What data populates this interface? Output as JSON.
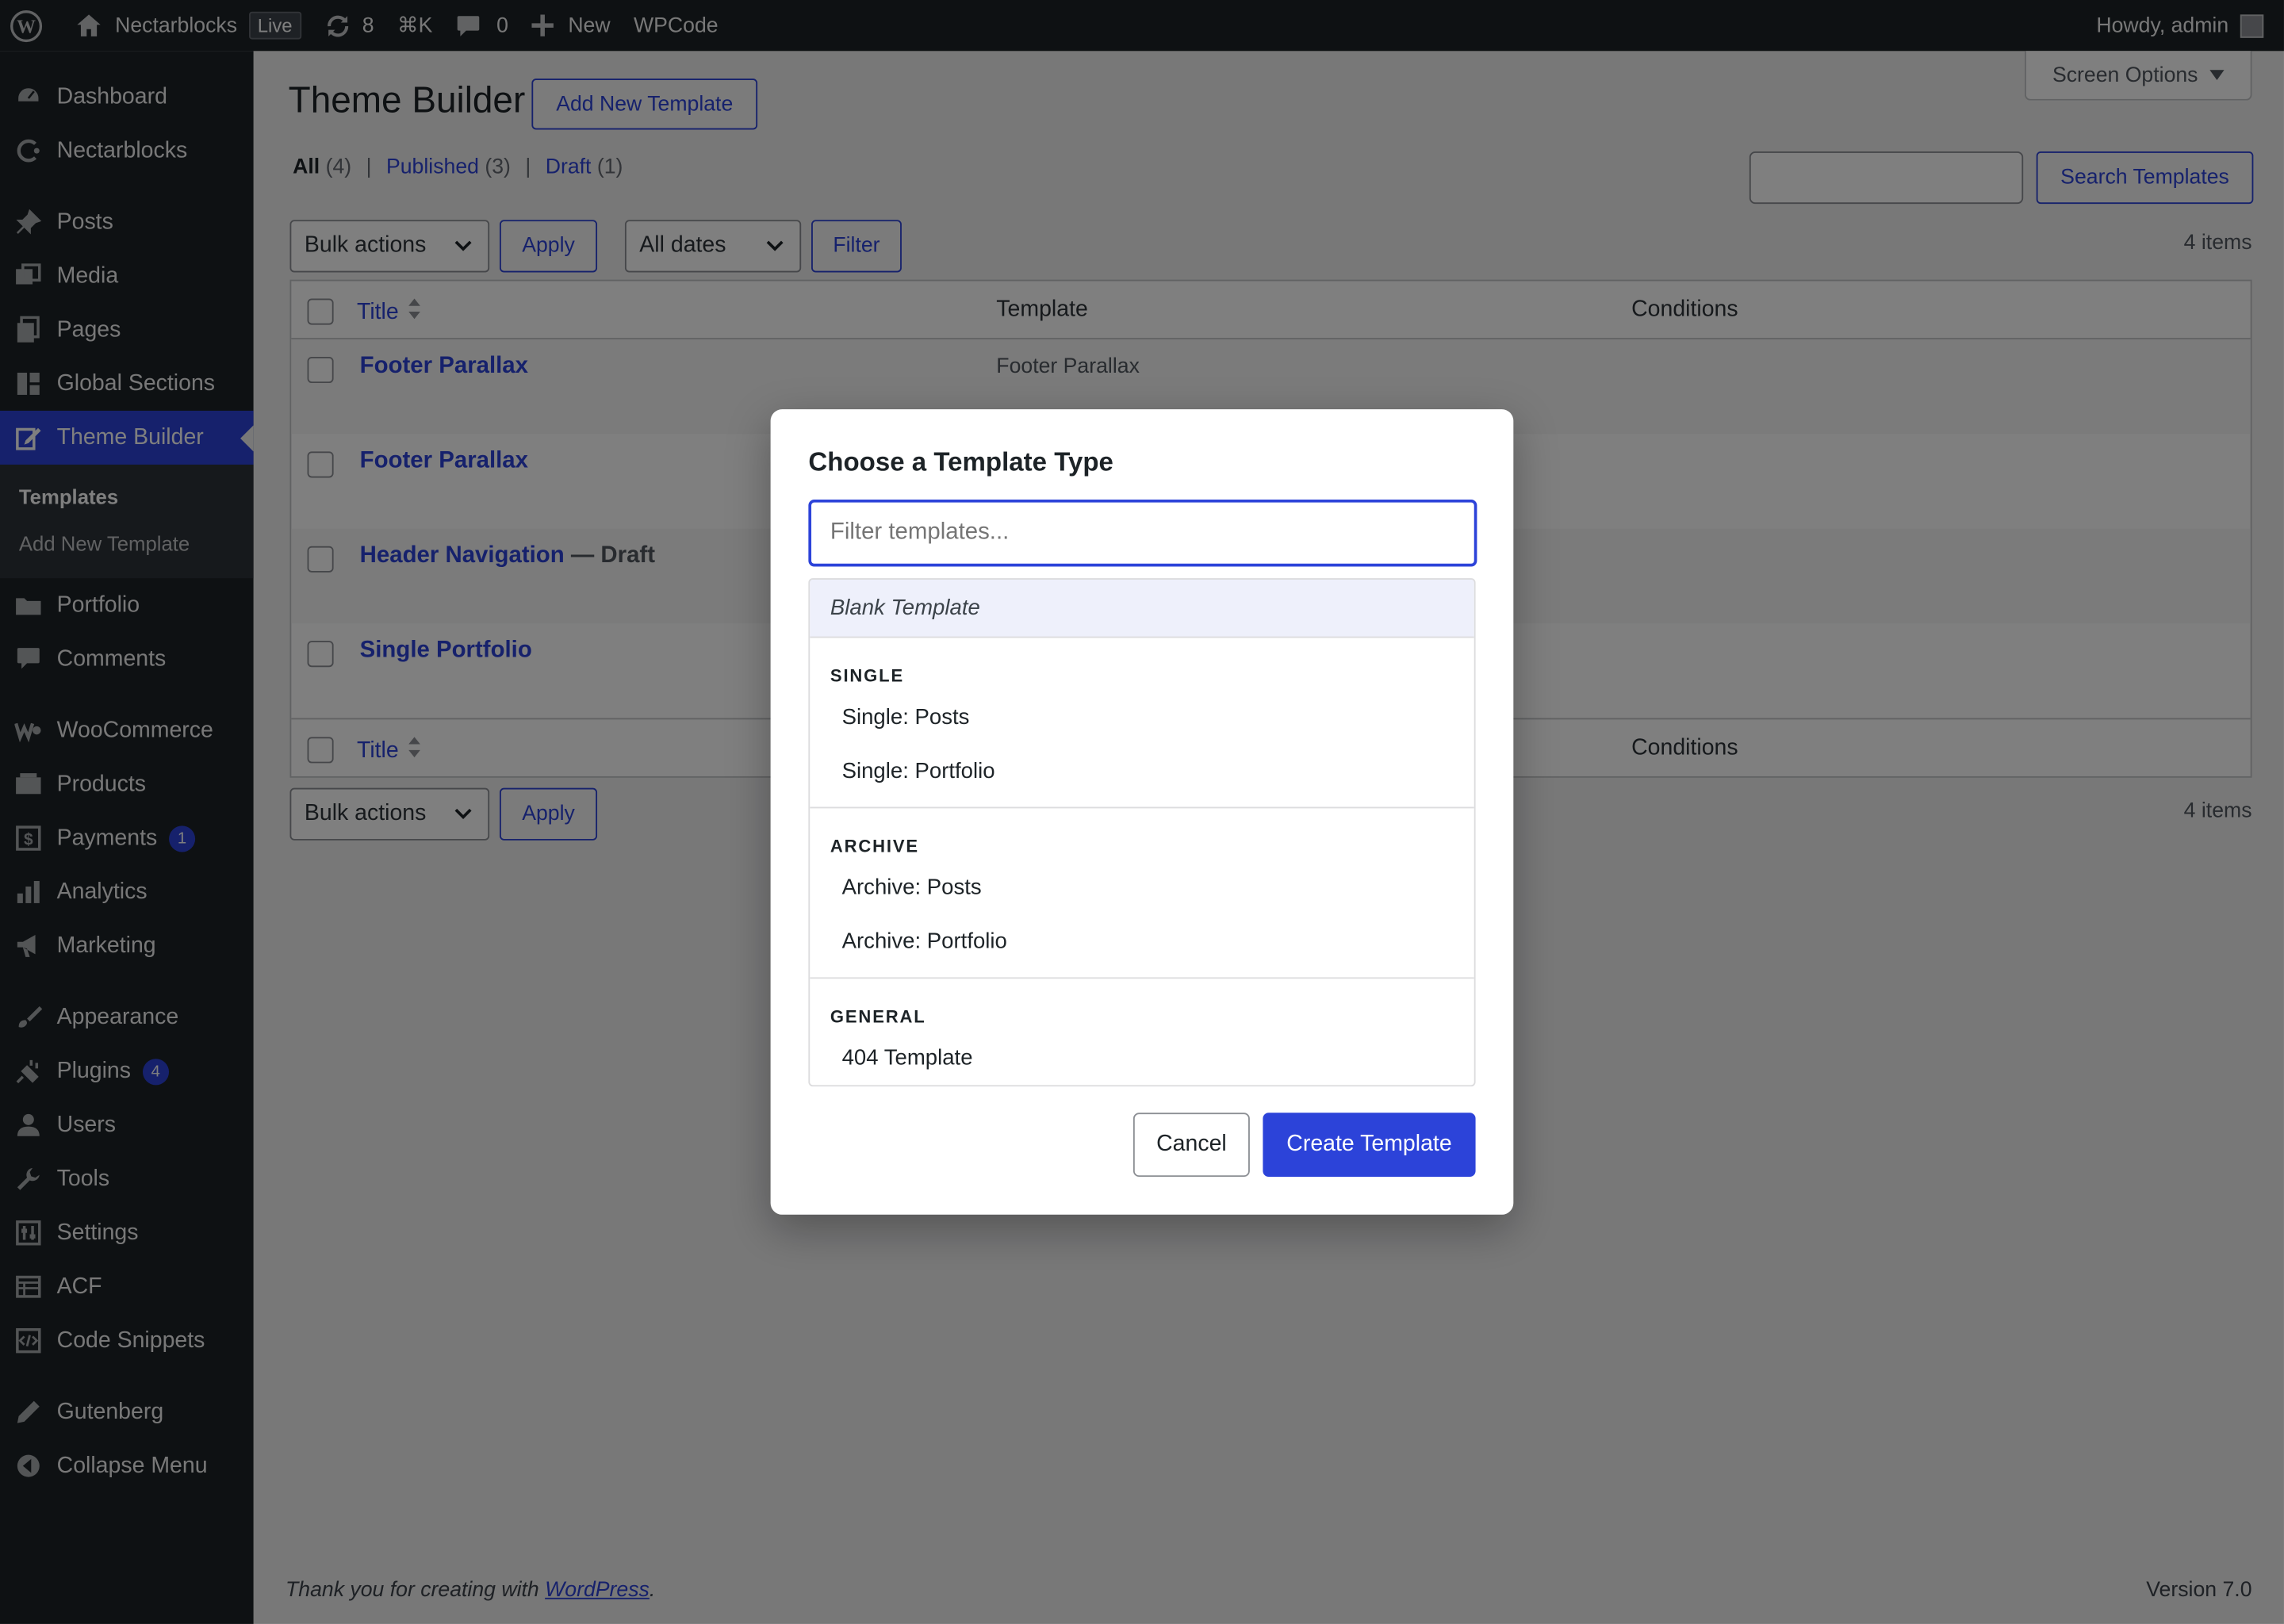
{
  "adminbar": {
    "site_name": "Nectarblocks",
    "live_badge": "Live",
    "updates_count": "8",
    "command_shortcut": "⌘K",
    "comments_count": "0",
    "new_label": "New",
    "wpcode_label": "WPCode",
    "howdy": "Howdy, admin"
  },
  "sidebar": {
    "dashboard": "Dashboard",
    "nectarblocks": "Nectarblocks",
    "posts": "Posts",
    "media": "Media",
    "pages": "Pages",
    "global_sections": "Global Sections",
    "theme_builder": "Theme Builder",
    "sub_templates": "Templates",
    "sub_add_new": "Add New Template",
    "portfolio": "Portfolio",
    "comments": "Comments",
    "woocommerce": "WooCommerce",
    "products": "Products",
    "payments": "Payments",
    "payments_badge": "1",
    "analytics": "Analytics",
    "marketing": "Marketing",
    "appearance": "Appearance",
    "plugins": "Plugins",
    "plugins_badge": "4",
    "users": "Users",
    "tools": "Tools",
    "settings": "Settings",
    "acf": "ACF",
    "code_snippets": "Code Snippets",
    "gutenberg": "Gutenberg",
    "collapse": "Collapse Menu"
  },
  "page": {
    "title": "Theme Builder",
    "add_new": "Add New Template",
    "screen_options": "Screen Options",
    "filters": {
      "all": "All",
      "all_count": "(4)",
      "published": "Published",
      "published_count": "(3)",
      "draft": "Draft",
      "draft_count": "(1)"
    },
    "search_button": "Search Templates",
    "bulk_actions": "Bulk actions",
    "apply": "Apply",
    "all_dates": "All dates",
    "filter": "Filter",
    "items_count": "4 items"
  },
  "table": {
    "col_title": "Title",
    "col_template": "Template",
    "col_conditions": "Conditions",
    "rows": [
      {
        "title": "Footer Parallax",
        "state": "",
        "template": "Footer Parallax"
      },
      {
        "title": "Footer Parallax",
        "state": "",
        "template": ""
      },
      {
        "title": "Header Navigation",
        "state": "— Draft",
        "template": ""
      },
      {
        "title": "Single Portfolio",
        "state": "",
        "template": ""
      }
    ]
  },
  "footer": {
    "thanks_prefix": "Thank you for creating with ",
    "wordpress_link": "WordPress",
    "thanks_suffix": ".",
    "version": "Version 7.0"
  },
  "modal": {
    "title": "Choose a Template Type",
    "filter_placeholder": "Filter templates...",
    "blank": "Blank Template",
    "groups": [
      {
        "label": "SINGLE",
        "items": [
          "Single: Posts",
          "Single: Portfolio"
        ]
      },
      {
        "label": "ARCHIVE",
        "items": [
          "Archive: Posts",
          "Archive: Portfolio"
        ]
      },
      {
        "label": "GENERAL",
        "items": [
          "404 Template"
        ]
      }
    ],
    "cancel": "Cancel",
    "create": "Create Template"
  },
  "colors": {
    "accent": "#2c43d9",
    "admin_dark": "#1d2327"
  }
}
